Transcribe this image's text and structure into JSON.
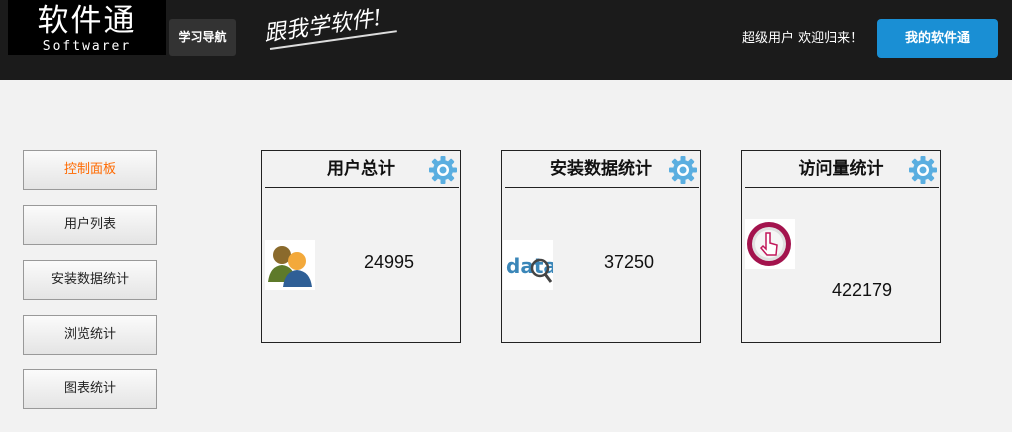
{
  "header": {
    "logo_cn": "软件通",
    "logo_en": "Softwarer",
    "nav_label": "学习导航",
    "slogan": "跟我学软件!",
    "welcome": "超级用户 欢迎归来！",
    "my_button": "我的软件通"
  },
  "sidebar": {
    "items": [
      {
        "label": "控制面板",
        "active": true
      },
      {
        "label": "用户列表",
        "active": false
      },
      {
        "label": "安装数据统计",
        "active": false
      },
      {
        "label": "浏览统计",
        "active": false
      },
      {
        "label": "图表统计",
        "active": false
      }
    ]
  },
  "cards": [
    {
      "title": "用户总计",
      "value": "24995",
      "icon": "users-icon"
    },
    {
      "title": "安装数据统计",
      "value": "37250",
      "icon": "data-icon"
    },
    {
      "title": "访问量统计",
      "value": "422179",
      "icon": "click-icon"
    }
  ],
  "colors": {
    "header_bg": "#1b1b1b",
    "accent": "#1a8fd4",
    "active_text": "#ff6a00",
    "gear": "#5aaee0"
  }
}
